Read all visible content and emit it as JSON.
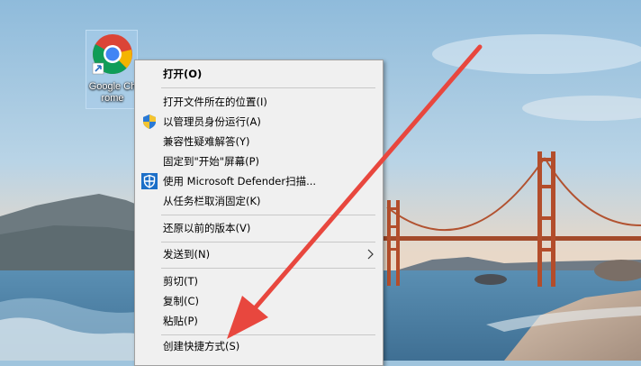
{
  "desktop": {
    "icon": {
      "name": "Google Chrome",
      "icon": "chrome-icon"
    }
  },
  "menu": {
    "items": [
      {
        "label": "打开(O)",
        "bold": true
      },
      {
        "label": "打开文件所在的位置(I)"
      },
      {
        "label": "以管理员身份运行(A)",
        "icon": "uac-shield-icon"
      },
      {
        "label": "兼容性疑难解答(Y)"
      },
      {
        "label": "固定到\"开始\"屏幕(P)"
      },
      {
        "label": "使用 Microsoft Defender扫描...",
        "icon": "defender-icon"
      },
      {
        "label": "从任务栏取消固定(K)"
      },
      {
        "label": "还原以前的版本(V)"
      },
      {
        "label": "发送到(N)",
        "submenu": true
      },
      {
        "label": "剪切(T)"
      },
      {
        "label": "复制(C)"
      },
      {
        "label": "粘贴(P)"
      },
      {
        "label": "创建快捷方式(S)"
      }
    ]
  },
  "colors": {
    "menu_bg": "#f0f0f0",
    "annotation": "#e8473e",
    "uac_blue": "#2a7ad5",
    "uac_yellow": "#f4c430",
    "defender_blue": "#1c6fc8"
  }
}
